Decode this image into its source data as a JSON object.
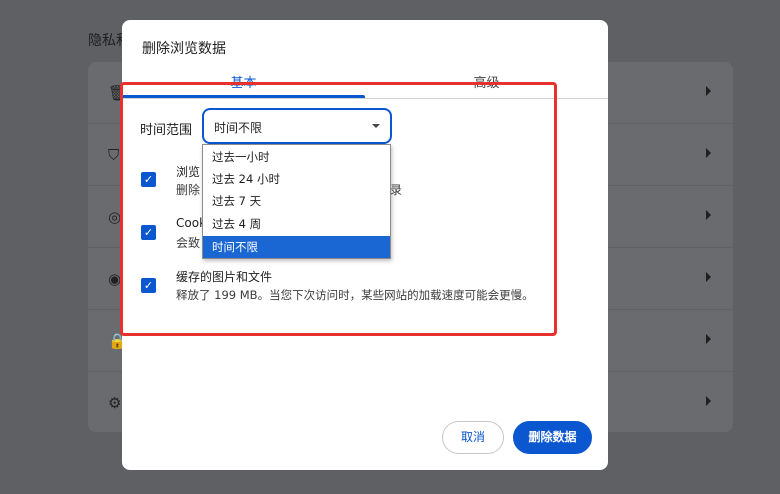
{
  "background": {
    "section_title": "隐私和",
    "row_icons": [
      "delete-icon",
      "shield-icon",
      "cookie-icon",
      "target-icon",
      "lock-icon",
      "tune-icon"
    ]
  },
  "dialog": {
    "title": "删除浏览数据",
    "tabs": [
      {
        "label": "基本",
        "active": true
      },
      {
        "label": "高级",
        "active": false
      }
    ],
    "time_range_label": "时间范围",
    "time_range_value": "时间不限",
    "options": [
      {
        "title": "浏览",
        "desc_start": "删除",
        "desc_end": "录",
        "checked": true
      },
      {
        "title": "Cook",
        "desc_start": "会致",
        "desc_end": "",
        "checked": true
      },
      {
        "title": "缓存的图片和文件",
        "desc_start": "释放了 199 MB。当您下次访问时，某些网站的加载速度可能会更慢。",
        "desc_end": "",
        "checked": true
      }
    ],
    "cancel_label": "取消",
    "delete_label": "删除数据"
  },
  "dropdown": {
    "items": [
      {
        "label": "过去一小时",
        "selected": false
      },
      {
        "label": "过去 24 小时",
        "selected": false
      },
      {
        "label": "过去 7 天",
        "selected": false
      },
      {
        "label": "过去 4 周",
        "selected": false
      },
      {
        "label": "时间不限",
        "selected": true
      }
    ]
  },
  "colors": {
    "accent": "#0b57d0",
    "selection": "#1a66d2",
    "annotation": "#e8302c",
    "overlay": "#5f6064"
  }
}
